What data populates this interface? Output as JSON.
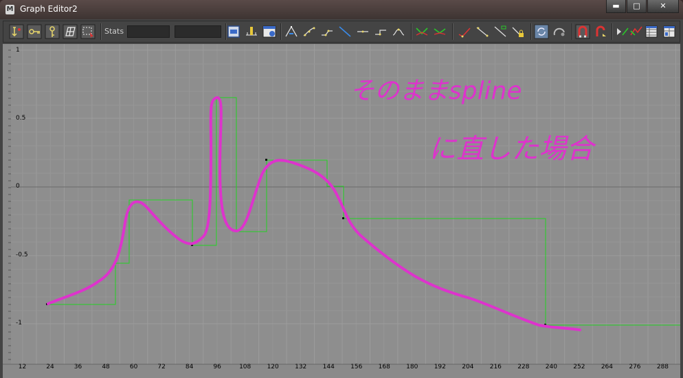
{
  "window": {
    "title": "Graph Editor2",
    "min_label": "▬",
    "max_label": "□",
    "close_label": "✕"
  },
  "toolbar": {
    "stats_label": "Stats"
  },
  "graph": {
    "y_labels": [
      "1",
      "0.5",
      "0",
      "-0.5",
      "-1"
    ],
    "x_labels": [
      "12",
      "24",
      "36",
      "48",
      "60",
      "72",
      "84",
      "96",
      "108",
      "120",
      "132",
      "144",
      "156",
      "168",
      "180",
      "192",
      "204",
      "216",
      "228",
      "240",
      "252",
      "264",
      "276",
      "288"
    ],
    "annotation_line1": "そのままspline",
    "annotation_line2": "に直した場合",
    "colors": {
      "background": "#8e8e8e",
      "stepped_curve": "#22d322",
      "spline_curve": "#dd33cc",
      "grid": "#9a9a9a"
    }
  }
}
